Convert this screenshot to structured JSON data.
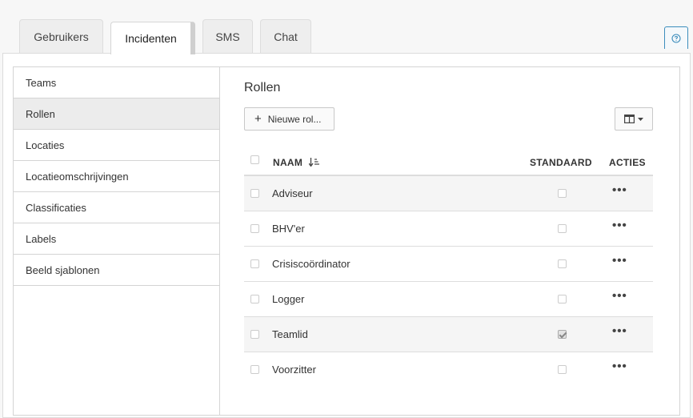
{
  "tabs": [
    {
      "label": "Gebruikers",
      "active": false
    },
    {
      "label": "Incidenten",
      "active": true
    },
    {
      "label": "SMS",
      "active": false
    },
    {
      "label": "Chat",
      "active": false
    }
  ],
  "help_icon": "question-circle-icon",
  "sidebar": {
    "items": [
      {
        "label": "Teams",
        "active": false
      },
      {
        "label": "Rollen",
        "active": true
      },
      {
        "label": "Locaties",
        "active": false
      },
      {
        "label": "Locatieomschrijvingen",
        "active": false
      },
      {
        "label": "Classificaties",
        "active": false
      },
      {
        "label": "Labels",
        "active": false
      },
      {
        "label": "Beeld sjablonen",
        "active": false
      }
    ]
  },
  "main": {
    "title": "Rollen",
    "new_button_label": "Nieuwe rol...",
    "columns_button_icon": "columns-icon",
    "table": {
      "headers": {
        "name": "NAAM",
        "default": "STANDAARD",
        "actions": "ACTIES"
      },
      "sort_icon": "sort-descending-icon",
      "rows": [
        {
          "name": "Adviseur",
          "default": false,
          "actions": "•••"
        },
        {
          "name": "BHV'er",
          "default": false,
          "actions": "•••"
        },
        {
          "name": "Crisiscoördinator",
          "default": false,
          "actions": "•••"
        },
        {
          "name": "Logger",
          "default": false,
          "actions": "•••"
        },
        {
          "name": "Teamlid",
          "default": true,
          "actions": "•••"
        },
        {
          "name": "Voorzitter",
          "default": false,
          "actions": "•••"
        }
      ]
    }
  },
  "colors": {
    "accent": "#3c8dbc",
    "border": "#d4d4d4",
    "active_bg": "#ececec"
  }
}
